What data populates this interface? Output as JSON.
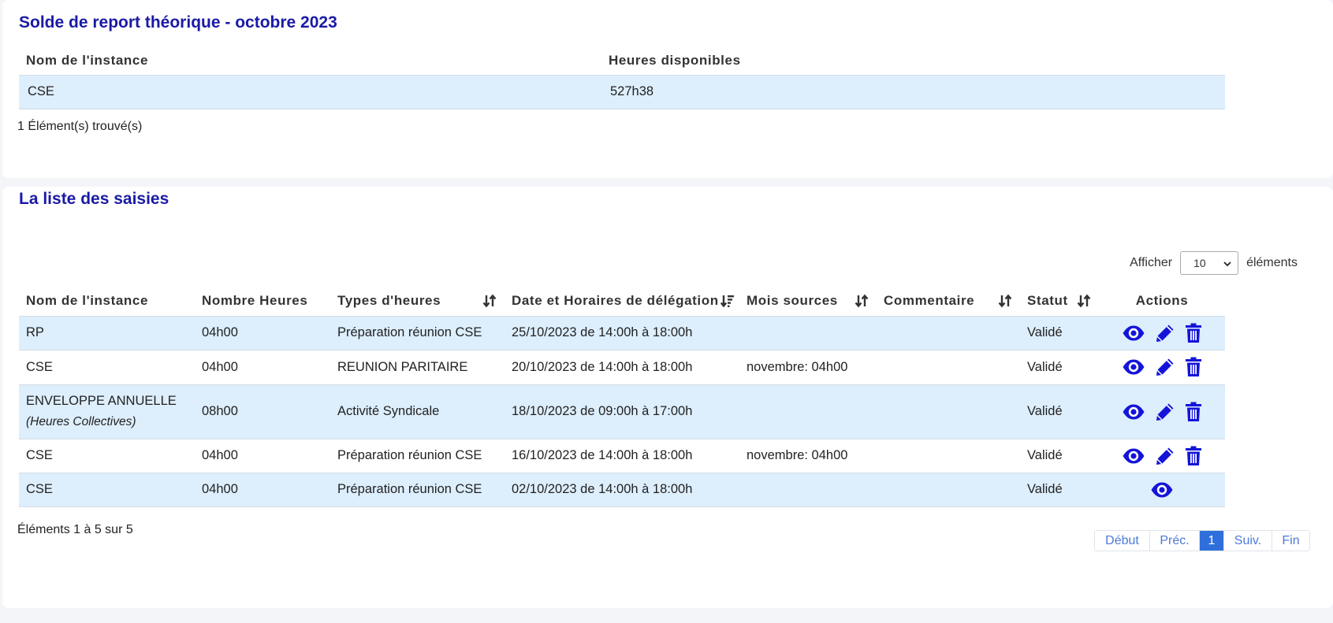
{
  "summary": {
    "title": "Solde de report théorique - octobre 2023",
    "columns": [
      "Nom de l'instance",
      "Heures disponibles"
    ],
    "rows": [
      {
        "instance": "CSE",
        "heures": "527h38"
      }
    ],
    "info": "1 Élément(s) trouvé(s)"
  },
  "list": {
    "title": "La liste des saisies",
    "length_label_before": "Afficher",
    "length_value": "10",
    "length_label_after": "éléments",
    "columns": {
      "instance": "Nom de l'instance",
      "nombre": "Nombre Heures",
      "types": "Types d'heures",
      "date": "Date et Horaires de délégation",
      "mois": "Mois sources",
      "commentaire": "Commentaire",
      "statut": "Statut",
      "actions": "Actions"
    },
    "rows": [
      {
        "instance": "RP",
        "instance_note": "",
        "nombre": "04h00",
        "types": "Préparation réunion CSE",
        "date": "25/10/2023 de 14:00h à 18:00h",
        "mois": "",
        "commentaire": "",
        "statut": "Validé"
      },
      {
        "instance": "CSE",
        "instance_note": "",
        "nombre": "04h00",
        "types": "REUNION PARITAIRE",
        "date": "20/10/2023 de 14:00h à 18:00h",
        "mois": "novembre: 04h00",
        "commentaire": "",
        "statut": "Validé"
      },
      {
        "instance": "ENVELOPPE ANNUELLE",
        "instance_note": "(Heures Collectives)",
        "nombre": "08h00",
        "types": "Activité Syndicale",
        "date": "18/10/2023 de 09:00h à 17:00h",
        "mois": "",
        "commentaire": "",
        "statut": "Validé"
      },
      {
        "instance": "CSE",
        "instance_note": "",
        "nombre": "04h00",
        "types": "Préparation réunion CSE",
        "date": "16/10/2023 de 14:00h à 18:00h",
        "mois": "novembre: 04h00",
        "commentaire": "",
        "statut": "Validé"
      },
      {
        "instance": "CSE",
        "instance_note": "",
        "nombre": "04h00",
        "types": "Préparation réunion CSE",
        "date": "02/10/2023 de 14:00h à 18:00h",
        "mois": "",
        "commentaire": "",
        "statut": "Validé"
      }
    ],
    "info": "Éléments 1 à 5 sur 5",
    "pagination": {
      "first": "Début",
      "prev": "Préc.",
      "current": "1",
      "next": "Suiv.",
      "last": "Fin"
    }
  },
  "colors": {
    "title": "#1a1aa6",
    "row_stripe": "#ddeefc",
    "action_icon": "#1414d9",
    "pager_active": "#2f6fdb"
  },
  "icons": {
    "sort": "sort-both-icon",
    "sort_desc": "sort-desc-icon",
    "view": "eye-icon",
    "edit": "pencil-icon",
    "delete": "trash-icon",
    "select": "chevron-down-icon"
  }
}
